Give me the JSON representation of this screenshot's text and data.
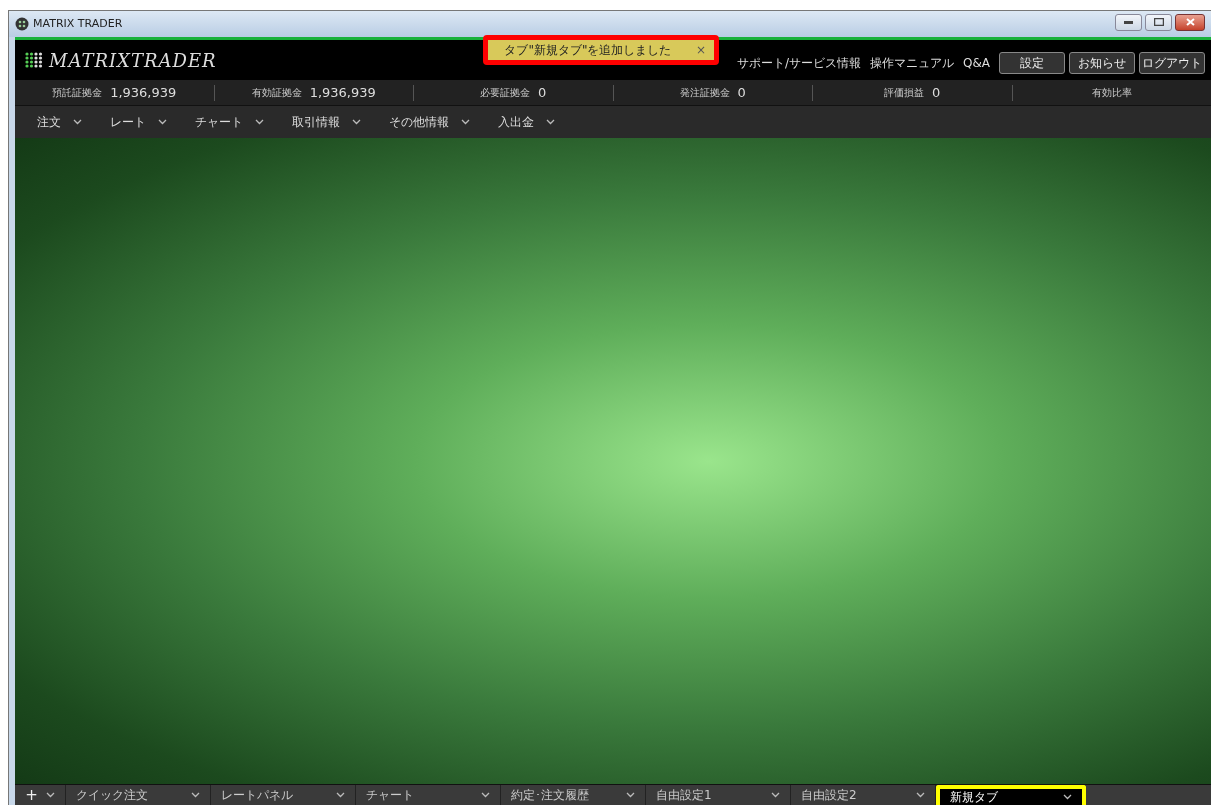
{
  "window": {
    "title": "MATRIX TRADER"
  },
  "header": {
    "logo": "MATRIXTRADER",
    "notification": {
      "text": "タブ\"新規タブ\"を追加しました",
      "close": "×"
    },
    "links": [
      "サポート/サービス情報",
      "操作マニュアル",
      "Q&A"
    ],
    "buttons": [
      "設定",
      "お知らせ",
      "ログアウト"
    ]
  },
  "stats": [
    {
      "label": "預託証拠金",
      "value": "1,936,939"
    },
    {
      "label": "有効証拠金",
      "value": "1,936,939"
    },
    {
      "label": "必要証拠金",
      "value": "0"
    },
    {
      "label": "発注証拠金",
      "value": "0"
    },
    {
      "label": "評価損益",
      "value": "0"
    },
    {
      "label": "有効比率"
    }
  ],
  "menu": [
    "注文",
    "レート",
    "チャート",
    "取引情報",
    "その他情報",
    "入出金"
  ],
  "bottom_tabs": [
    {
      "label": "クイック注文",
      "selected": false
    },
    {
      "label": "レートパネル",
      "selected": false
    },
    {
      "label": "チャート",
      "selected": false
    },
    {
      "label": "約定･注文履歴",
      "selected": false
    },
    {
      "label": "自由設定1",
      "selected": false
    },
    {
      "label": "自由設定2",
      "selected": false
    },
    {
      "label": "新規タブ",
      "selected": true
    }
  ],
  "add_tab": "+"
}
